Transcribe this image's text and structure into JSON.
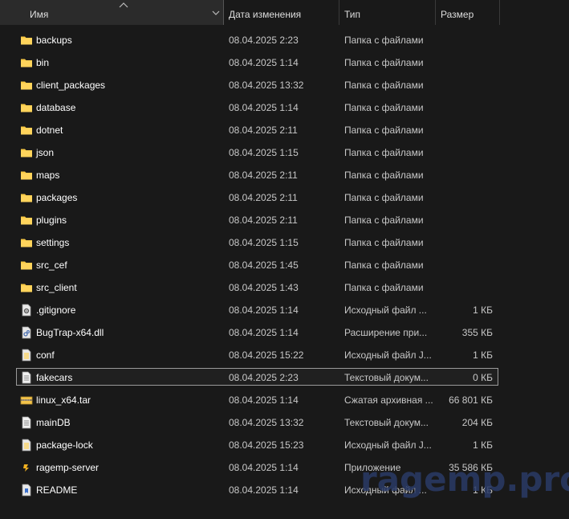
{
  "columns": {
    "name": "Имя",
    "date": "Дата изменения",
    "type": "Тип",
    "size": "Размер"
  },
  "files": [
    {
      "name": "backups",
      "date": "08.04.2025 2:23",
      "type": "Папка с файлами",
      "size": "",
      "icon": "folder-icon"
    },
    {
      "name": "bin",
      "date": "08.04.2025 1:14",
      "type": "Папка с файлами",
      "size": "",
      "icon": "folder-icon"
    },
    {
      "name": "client_packages",
      "date": "08.04.2025 13:32",
      "type": "Папка с файлами",
      "size": "",
      "icon": "folder-icon"
    },
    {
      "name": "database",
      "date": "08.04.2025 1:14",
      "type": "Папка с файлами",
      "size": "",
      "icon": "folder-icon"
    },
    {
      "name": "dotnet",
      "date": "08.04.2025 2:11",
      "type": "Папка с файлами",
      "size": "",
      "icon": "folder-icon"
    },
    {
      "name": "json",
      "date": "08.04.2025 1:15",
      "type": "Папка с файлами",
      "size": "",
      "icon": "folder-icon"
    },
    {
      "name": "maps",
      "date": "08.04.2025 2:11",
      "type": "Папка с файлами",
      "size": "",
      "icon": "folder-icon"
    },
    {
      "name": "packages",
      "date": "08.04.2025 2:11",
      "type": "Папка с файлами",
      "size": "",
      "icon": "folder-icon"
    },
    {
      "name": "plugins",
      "date": "08.04.2025 2:11",
      "type": "Папка с файлами",
      "size": "",
      "icon": "folder-icon"
    },
    {
      "name": "settings",
      "date": "08.04.2025 1:15",
      "type": "Папка с файлами",
      "size": "",
      "icon": "folder-icon"
    },
    {
      "name": "src_cef",
      "date": "08.04.2025 1:45",
      "type": "Папка с файлами",
      "size": "",
      "icon": "folder-icon"
    },
    {
      "name": "src_client",
      "date": "08.04.2025 1:43",
      "type": "Папка с файлами",
      "size": "",
      "icon": "folder-icon"
    },
    {
      "name": ".gitignore",
      "date": "08.04.2025 1:14",
      "type": "Исходный файл ...",
      "size": "1 КБ",
      "icon": "gear-file-icon"
    },
    {
      "name": "BugTrap-x64.dll",
      "date": "08.04.2025 1:14",
      "type": "Расширение при...",
      "size": "355 КБ",
      "icon": "dll-file-icon"
    },
    {
      "name": "conf",
      "date": "08.04.2025 15:22",
      "type": "Исходный файл J...",
      "size": "1 КБ",
      "icon": "json-file-icon"
    },
    {
      "name": "fakecars",
      "date": "08.04.2025 2:23",
      "type": "Текстовый докум...",
      "size": "0 КБ",
      "icon": "text-file-icon",
      "selected": true
    },
    {
      "name": "linux_x64.tar",
      "date": "08.04.2025 1:14",
      "type": "Сжатая архивная ...",
      "size": "66 801 КБ",
      "icon": "archive-icon"
    },
    {
      "name": "mainDB",
      "date": "08.04.2025 13:32",
      "type": "Текстовый докум...",
      "size": "204 КБ",
      "icon": "text-file-icon"
    },
    {
      "name": "package-lock",
      "date": "08.04.2025 15:23",
      "type": "Исходный файл J...",
      "size": "1 КБ",
      "icon": "json-file-icon"
    },
    {
      "name": "ragemp-server",
      "date": "08.04.2025 1:14",
      "type": "Приложение",
      "size": "35 586 КБ",
      "icon": "app-icon"
    },
    {
      "name": "README",
      "date": "08.04.2025 1:14",
      "type": "Исходный файл ...",
      "size": "1 КБ",
      "icon": "readme-file-icon"
    }
  ],
  "watermark": "ragemp.pro",
  "colors": {
    "folder": "#f8c944",
    "background": "#191919",
    "header_active": "#2b2b2b",
    "watermark": "#2a3a66"
  }
}
